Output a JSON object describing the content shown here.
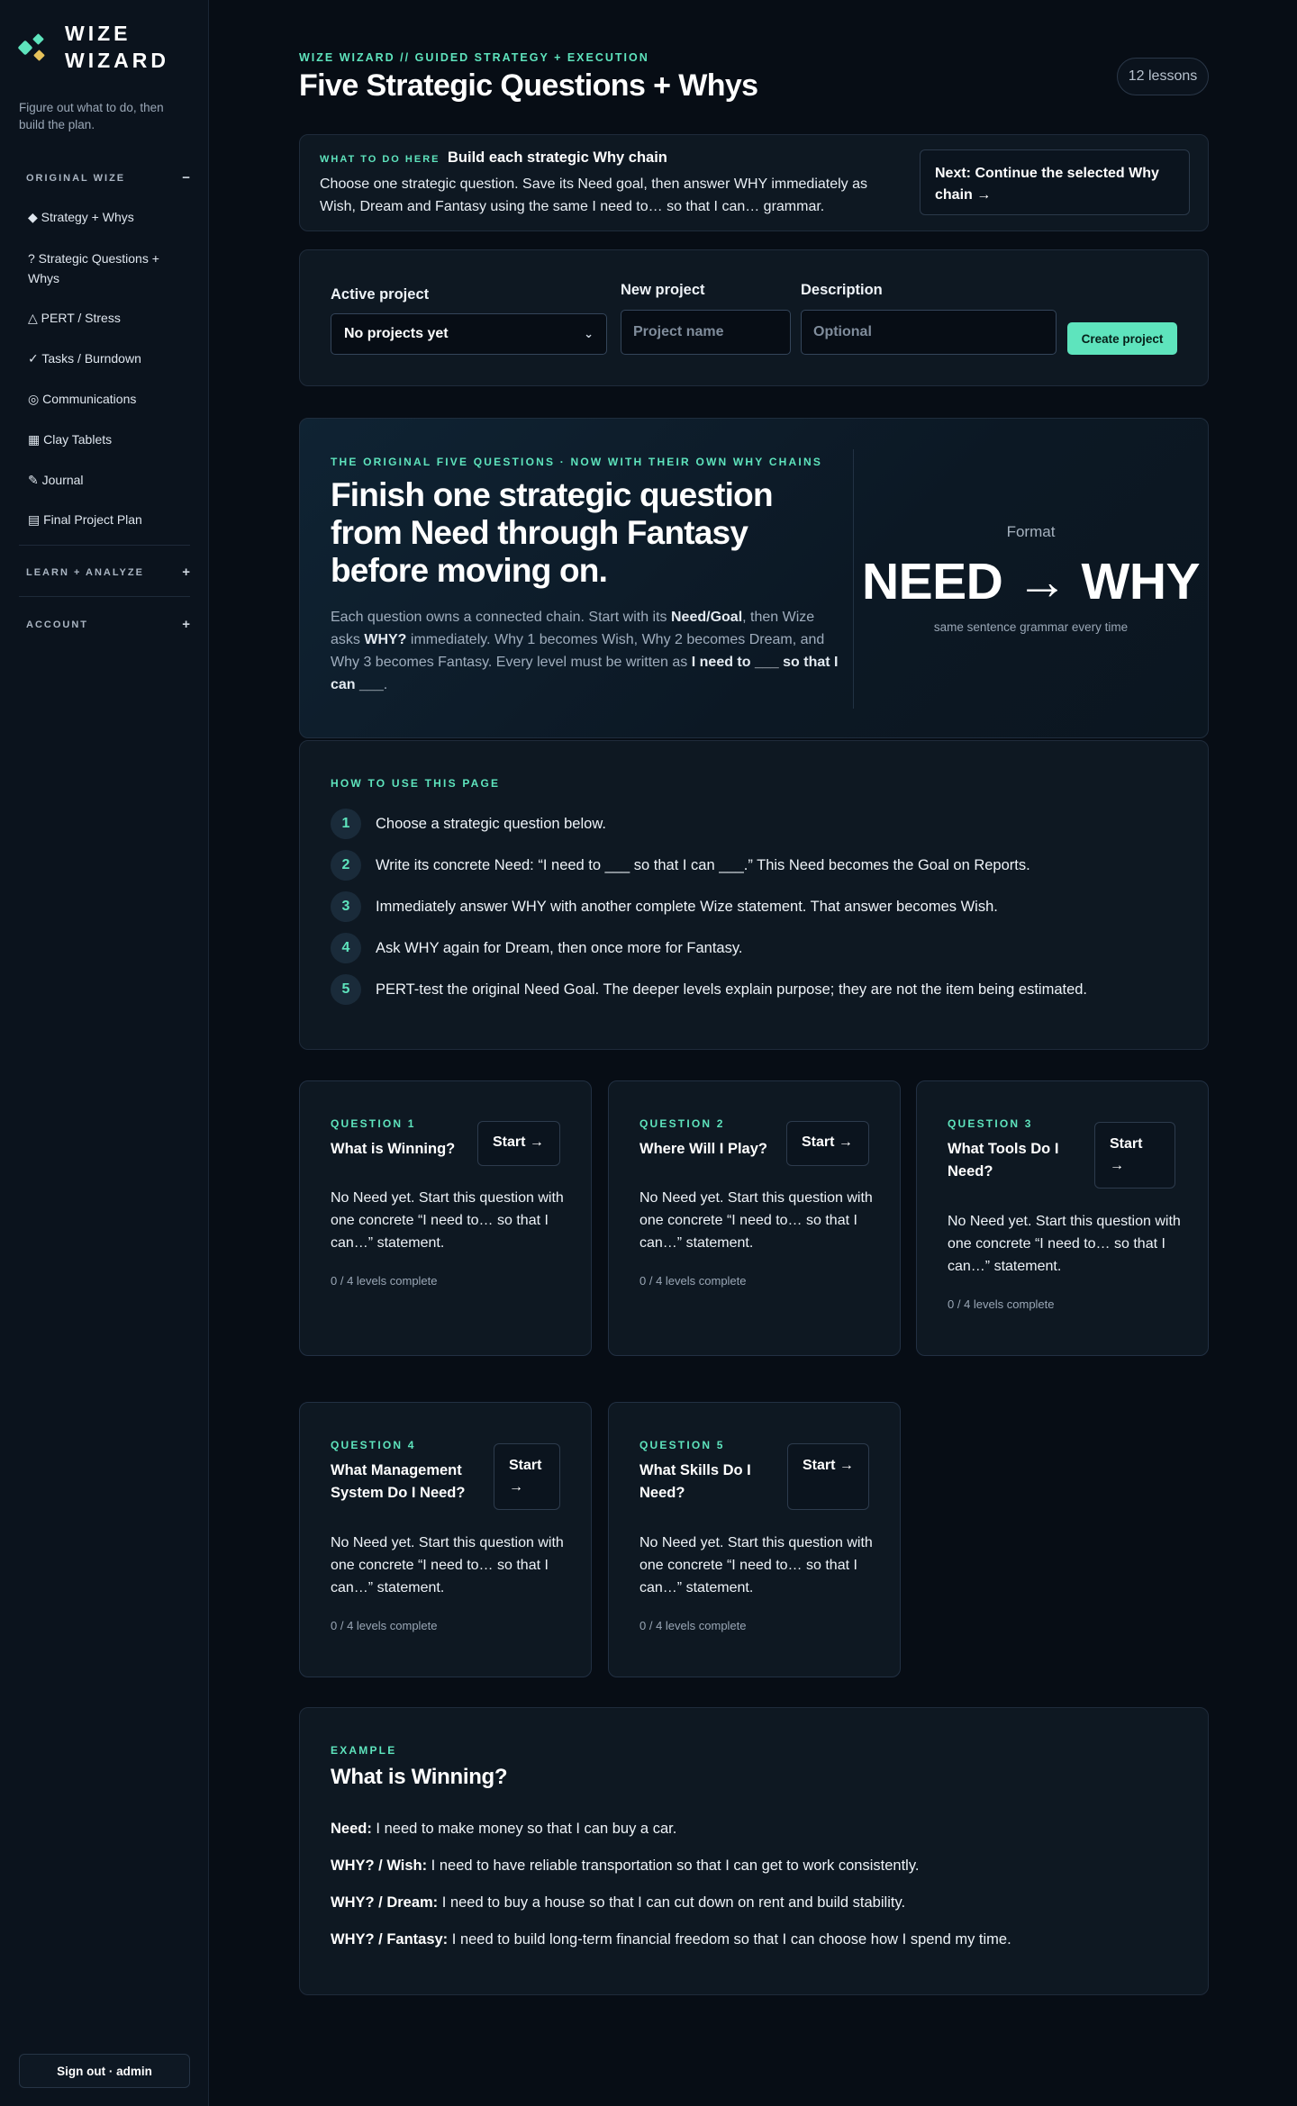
{
  "brand": {
    "line1": "WIZE",
    "line2": "WIZARD",
    "tagline": "Figure out what to do, then build the plan."
  },
  "sidebar": {
    "sections": [
      {
        "label": "ORIGINAL WIZE",
        "toggle": "−"
      },
      {
        "label": "LEARN + ANALYZE",
        "toggle": "+"
      },
      {
        "label": "ACCOUNT",
        "toggle": "+"
      }
    ],
    "items": [
      {
        "label": "◆ Strategy + Whys"
      },
      {
        "label": "? Strategic Questions + Whys"
      },
      {
        "label": "△ PERT / Stress"
      },
      {
        "label": "✓ Tasks / Burndown"
      },
      {
        "label": "◎ Communications"
      },
      {
        "label": "▦ Clay Tablets"
      },
      {
        "label": "✎ Journal"
      },
      {
        "label": "▤ Final Project Plan"
      }
    ],
    "signout": "Sign out · admin"
  },
  "header": {
    "eyebrow": "WIZE WIZARD // GUIDED STRATEGY + EXECUTION",
    "title": "Five Strategic Questions + Whys",
    "lessons": "12 lessons"
  },
  "hint": {
    "eyebrow": "WHAT TO DO HERE",
    "title": "Build each strategic Why chain",
    "body": "Choose one strategic question. Save its Need goal, then answer WHY immediately as Wish, Dream and Fantasy using the same I need to… so that I can… grammar.",
    "next": "Next: Continue the selected Why chain →"
  },
  "project": {
    "active_label": "Active project",
    "active_value": "No projects yet",
    "new_label": "New project",
    "new_placeholder": "Project name",
    "desc_label": "Description",
    "desc_placeholder": "Optional",
    "create": "Create project"
  },
  "hero": {
    "eyebrow": "THE ORIGINAL FIVE QUESTIONS · NOW WITH THEIR OWN WHY CHAINS",
    "title": "Finish one strategic question from Need through Fantasy before moving on.",
    "body_1": "Each question owns a connected chain. Start with its ",
    "body_bold_1": "Need/Goal",
    "body_2": ", then Wize asks ",
    "body_bold_2": "WHY?",
    "body_3": " immediately. Why 1 becomes Wish, Why 2 becomes Dream, and Why 3 becomes Fantasy. Every level must be written as ",
    "body_bold_3": "I need to ___ so that I can ___",
    "body_4": ".",
    "format_label": "Format",
    "format_big": "NEED → WHY",
    "format_sub": "same sentence grammar every time"
  },
  "howto": {
    "eyebrow": "HOW TO USE THIS PAGE",
    "steps": [
      {
        "num": "1",
        "text": "Choose a strategic question below."
      },
      {
        "num": "2",
        "text": "Write its concrete Need: “I need to ___ so that I can ___.” This Need becomes the Goal on Reports."
      },
      {
        "num": "3",
        "text": "Immediately answer WHY with another complete Wize statement. That answer becomes Wish."
      },
      {
        "num": "4",
        "text": "Ask WHY again for Dream, then once more for Fantasy."
      },
      {
        "num": "5",
        "text": "PERT-test the original Need Goal. The deeper levels explain purpose; they are not the item being estimated."
      }
    ]
  },
  "questions": [
    {
      "eyebrow": "QUESTION 1",
      "title": "What is Winning?",
      "start": "Start →",
      "body": "No Need yet. Start this question with one concrete “I need to… so that I can…” statement.",
      "progress": "0 / 4 levels complete"
    },
    {
      "eyebrow": "QUESTION 2",
      "title": "Where Will I Play?",
      "start": "Start →",
      "body": "No Need yet. Start this question with one concrete “I need to… so that I can…” statement.",
      "progress": "0 / 4 levels complete"
    },
    {
      "eyebrow": "QUESTION 3",
      "title": "What Tools Do I Need?",
      "start": "Start →",
      "body": "No Need yet. Start this question with one concrete “I need to… so that I can…” statement.",
      "progress": "0 / 4 levels complete"
    },
    {
      "eyebrow": "QUESTION 4",
      "title": "What Management System Do I Need?",
      "start": "Start →",
      "body": "No Need yet. Start this question with one concrete “I need to… so that I can…” statement.",
      "progress": "0 / 4 levels complete"
    },
    {
      "eyebrow": "QUESTION 5",
      "title": "What Skills Do I Need?",
      "start": "Start →",
      "body": "No Need yet. Start this question with one concrete “I need to… so that I can…” statement.",
      "progress": "0 / 4 levels complete"
    }
  ],
  "example": {
    "eyebrow": "EXAMPLE",
    "title": "What is Winning?",
    "lines": [
      {
        "label": "Need:",
        "text": " I need to make money so that I can buy a car."
      },
      {
        "label": "WHY? / Wish:",
        "text": " I need to have reliable transportation so that I can get to work consistently."
      },
      {
        "label": "WHY? / Dream:",
        "text": " I need to buy a house so that I can cut down on rent and build stability."
      },
      {
        "label": "WHY? / Fantasy:",
        "text": " I need to build long-term financial freedom so that I can choose how I spend my time."
      }
    ]
  },
  "colors": {
    "accent": "#5ee4bd",
    "logo_secondary": "#e7c25a",
    "background": "#070d15"
  }
}
